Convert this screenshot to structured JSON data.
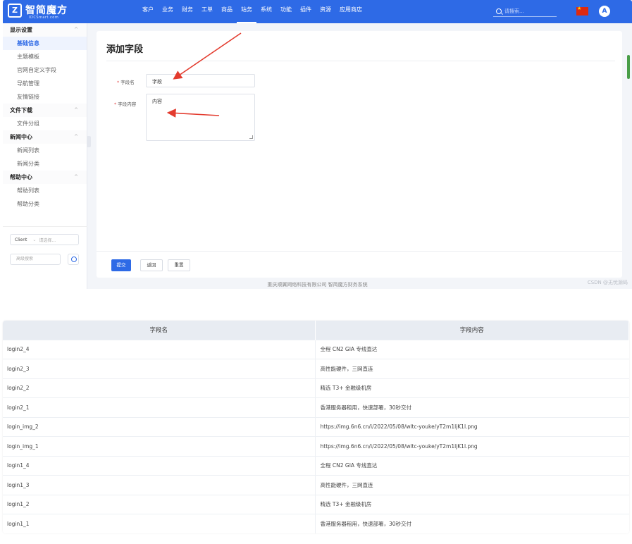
{
  "brand": {
    "name": "智简魔方",
    "sub": "IDCSmart.com",
    "mark": "Z"
  },
  "nav": [
    "客户",
    "业务",
    "财务",
    "工单",
    "商品",
    "站务",
    "系统",
    "功能",
    "插件",
    "资源",
    "应用商店"
  ],
  "nav_active_index": 5,
  "search_placeholder": "请搜索...",
  "avatar_letter": "A",
  "sidebar": {
    "groups": [
      {
        "label": "显示设置",
        "items": [
          "基础信息",
          "主题模板",
          "官网自定义字段",
          "导航管理",
          "友情链接"
        ]
      },
      {
        "label": "文件下载",
        "items": [
          "文件分组"
        ]
      },
      {
        "label": "新闻中心",
        "items": [
          "新闻列表",
          "新闻分类"
        ]
      },
      {
        "label": "帮助中心",
        "items": [
          "帮助列表",
          "帮助分类"
        ]
      }
    ],
    "active_item": "基础信息",
    "client_select": "Client",
    "client_select_placeholder": "请选择...",
    "advanced_search_placeholder": "高级搜索"
  },
  "form": {
    "title": "添加字段",
    "field_name_label": "字段名",
    "field_name_value": "字段",
    "field_content_label": "字段内容",
    "field_content_value": "内容",
    "submit_label": "提交",
    "back_label": "返回",
    "reset_label": "重置"
  },
  "copyright": "重庆顺翼网络科技有限公司 智简魔方财务系统",
  "watermark": "CSDN @无忧源码",
  "colors": {
    "primary": "#2e6ae6",
    "arrow": "#e33b2e",
    "required": "#e34d4d"
  },
  "table": {
    "headers": [
      "字段名",
      "字段内容"
    ],
    "rows": [
      [
        "login2_4",
        "全程 CN2 GIA 专线直达"
      ],
      [
        "login2_3",
        "高性能硬件，三网直连"
      ],
      [
        "login2_2",
        "精选 T3+ 金融级机房"
      ],
      [
        "login2_1",
        "香港服务器租用，快速部署，30秒交付"
      ],
      [
        "login_img_2",
        "https://img.6n6.cn/i/2022/05/08/wltc-youke/yT2m1ljK1l.png"
      ],
      [
        "login_img_1",
        "https://img.6n6.cn/i/2022/05/08/wltc-youke/yT2m1ljK1l.png"
      ],
      [
        "login1_4",
        "全程 CN2 GIA 专线直达"
      ],
      [
        "login1_3",
        "高性能硬件，三网直连"
      ],
      [
        "login1_2",
        "精选 T3+ 金融级机房"
      ],
      [
        "login1_1",
        "香港服务器租用，快速部署，30秒交付"
      ]
    ]
  }
}
